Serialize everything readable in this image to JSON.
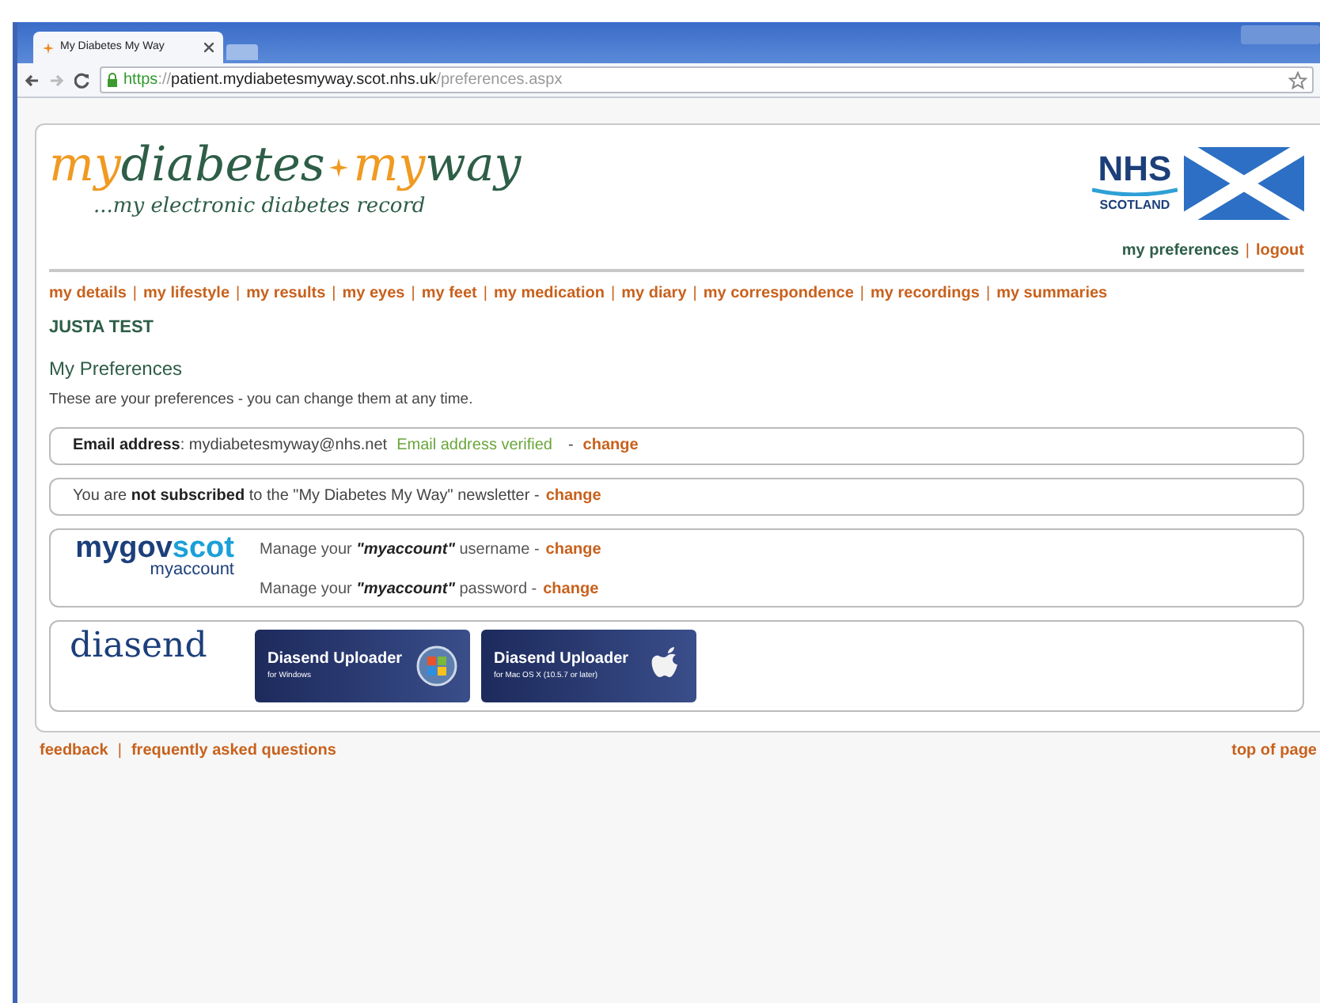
{
  "browser": {
    "tab_title": "My Diabetes My Way",
    "url_scheme": "https",
    "url_sep": "://",
    "url_host": "patient.mydiabetesmyway.scot.nhs.uk",
    "url_path": "/preferences.aspx"
  },
  "header": {
    "logo": {
      "part_1": "my",
      "part_2": "diabetes",
      "part_3": "my",
      "part_4": "way",
      "tagline": "...my electronic diabetes record"
    },
    "nhs_logo": {
      "name": "NHS",
      "region": "SCOTLAND"
    },
    "links": [
      {
        "label": "my preferences"
      },
      {
        "label": "logout"
      }
    ],
    "separator": "|"
  },
  "nav": {
    "separator": "|",
    "items": [
      {
        "label": "my details"
      },
      {
        "label": "my lifestyle"
      },
      {
        "label": "my results"
      },
      {
        "label": "my eyes"
      },
      {
        "label": "my feet"
      },
      {
        "label": "my medication"
      },
      {
        "label": "my diary"
      },
      {
        "label": "my correspondence"
      },
      {
        "label": "my recordings"
      },
      {
        "label": "my summaries"
      }
    ]
  },
  "user_name": "JUSTA TEST",
  "heading": "My Preferences",
  "intro": "These are your preferences - you can change them at any time.",
  "email": {
    "text": "**Email address**: mydiabetesmyway@nhs.net",
    "status": "Email address verified",
    "dash": "-",
    "link": "change"
  },
  "newsletter": {
    "text": "You are **not subscribed** to the \"My Diabetes My Way\" newsletter -",
    "link": "change"
  },
  "myaccount": {
    "logo": {
      "part_1": "mygov",
      "part_2": "scot",
      "sub": "myaccount"
    },
    "rows": [
      {
        "text": "Manage your **\"myaccount\"** username -",
        "link": "change"
      },
      {
        "text": "Manage your **\"myaccount\"** password -",
        "link": "change"
      }
    ]
  },
  "diasend": {
    "logo": "diasend",
    "buttons": [
      {
        "kind": "windows",
        "title": "Diasend Uploader",
        "subtitle": "for Windows"
      },
      {
        "kind": "mac",
        "title": "Diasend Uploader",
        "subtitle": "for Mac OS X (10.5.7 or later)"
      }
    ]
  },
  "footer": {
    "links": [
      {
        "label": "feedback"
      },
      {
        "label": "frequently asked questions"
      }
    ],
    "separator": "|",
    "top_link": "top of page"
  }
}
